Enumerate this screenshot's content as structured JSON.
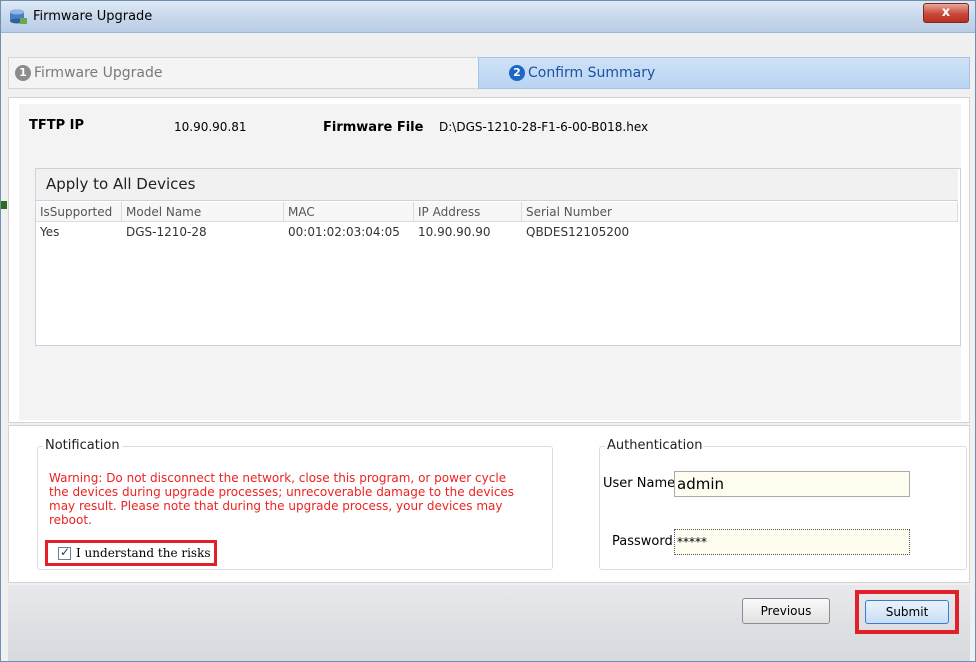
{
  "window": {
    "title": "Firmware Upgrade",
    "close_label": "x"
  },
  "steps": [
    {
      "number": "1",
      "label": "Firmware Upgrade",
      "active": false
    },
    {
      "number": "2",
      "label": "Confirm Summary",
      "active": true
    }
  ],
  "summary": {
    "tftp_label": "TFTP IP",
    "tftp_value": "10.90.90.81",
    "firmware_label": "Firmware File",
    "firmware_value": "D:\\DGS-1210-28-F1-6-00-B018.hex"
  },
  "devices": {
    "title": "Apply to All Devices",
    "columns": [
      "IsSupported",
      "Model Name",
      "MAC",
      "IP Address",
      "Serial Number"
    ],
    "rows": [
      [
        "Yes",
        "DGS-1210-28",
        "00:01:02:03:04:05",
        "10.90.90.90",
        "QBDES12105200"
      ]
    ]
  },
  "notification": {
    "title": "Notification",
    "warning": "Warning: Do not disconnect the network, close this program, or power cycle the devices during upgrade processes; unrecoverable damage to the devices may result. Please note that during the upgrade process, your devices may reboot.",
    "checkbox_label": "I understand the risks",
    "checkbox_checked": true
  },
  "authentication": {
    "title": "Authentication",
    "username_label": "User Name",
    "username_value": "admin",
    "password_label": "Password",
    "password_value": "*****"
  },
  "footer": {
    "previous_label": "Previous",
    "submit_label": "Submit"
  },
  "colors": {
    "highlight": "#e2202a",
    "warning_text": "#ee2222",
    "step_active": "#1f67c4"
  }
}
